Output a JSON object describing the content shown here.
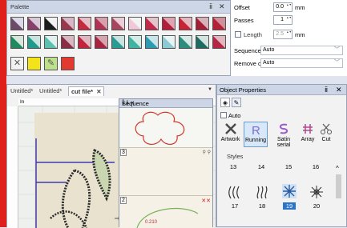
{
  "palette": {
    "title": "Palette",
    "pin_glyph": "ⅱ",
    "close_glyph": "✕",
    "swatches_row1": [
      {
        "c1": "#dcd9e6",
        "c2": "#6b4a6a"
      },
      {
        "c1": "#d7c9d8",
        "c2": "#87406a"
      },
      {
        "c1": "#f2f2f2",
        "c2": "#1c1c1c"
      },
      {
        "c1": "#d9b7c4",
        "c2": "#99354d"
      },
      {
        "c1": "#e3bfc8",
        "c2": "#c52a3e"
      },
      {
        "c1": "#d6a0ac",
        "c2": "#b23454"
      },
      {
        "c1": "#e9cdd7",
        "c2": "#a8465d"
      },
      {
        "c1": "#f3f3f3",
        "c2": "#f0c8d8"
      },
      {
        "c1": "#e6c4cc",
        "c2": "#c2294a"
      },
      {
        "c1": "#dca5b1",
        "c2": "#b31f3a"
      },
      {
        "c1": "#e4b8c1",
        "c2": "#c82335"
      },
      {
        "c1": "#d8b2bb",
        "c2": "#a61e33"
      },
      {
        "c1": "#cf8f9c",
        "c2": "#b52235"
      }
    ],
    "swatches_row2": [
      {
        "c1": "#d4e6dd",
        "c2": "#1e8a5e"
      },
      {
        "c1": "#c8e4e0",
        "c2": "#1f9b8d"
      },
      {
        "c1": "#e2f1ee",
        "c2": "#5bc0b0"
      },
      {
        "c1": "#d9b8c1",
        "c2": "#8a2d45"
      },
      {
        "c1": "#e0b6c0",
        "c2": "#c3233f"
      },
      {
        "c1": "#d7a4ae",
        "c2": "#a82440"
      },
      {
        "c1": "#c9e3e0",
        "c2": "#2a9c94"
      },
      {
        "c1": "#d2ece6",
        "c2": "#3fb4a2"
      },
      {
        "c1": "#c9e5e8",
        "c2": "#2a9bb2"
      },
      {
        "c1": "#e8f3f4",
        "c2": "#8bcad2"
      },
      {
        "c1": "#d6e9e4",
        "c2": "#2c8e7c"
      },
      {
        "c1": "#d4e5e1",
        "c2": "#1d6c63"
      },
      {
        "c1": "#e0b7c1",
        "c2": "#b72544"
      }
    ],
    "tools": [
      {
        "name": "no-color-icon",
        "glyph": "✕",
        "bg": "#f2f2f2"
      },
      {
        "name": "yellow-swatch",
        "glyph": "",
        "bg": "#f4e21a"
      },
      {
        "name": "eyedropper-icon",
        "glyph": "✎",
        "bg": "#bfe08a"
      },
      {
        "name": "red-swatch",
        "glyph": "",
        "bg": "#e23a2e"
      }
    ]
  },
  "options": {
    "offset_label": "Offset",
    "offset_value": "0.0",
    "offset_unit": "mm",
    "passes_label": "Passes",
    "passes_value": "1",
    "length_label": "Length",
    "length_value": "2.5",
    "length_unit": "mm",
    "sequence_label": "Sequence",
    "sequence_value": "Auto",
    "remove_overlaps_label": "Remove overlaps",
    "remove_overlaps_value": "Auto"
  },
  "docs": {
    "tabs": [
      "Untitled*",
      "Untitled*",
      "cut file*"
    ],
    "active_tab_close": "✕",
    "dropdown_glyph": "▼",
    "ruler_unit": "In",
    "ruler_zero": "0"
  },
  "sequence": {
    "title": "Sequence",
    "title_controls": "ⅱ ⅱ ✕",
    "items": [
      "3",
      "2"
    ],
    "ruler_mark": "0.210"
  },
  "props": {
    "title": "Object Properties",
    "pin_glyph": "ⅱ",
    "close_glyph": "✕",
    "auto_label": "Auto",
    "tools": [
      "Artwork",
      "Running",
      "Satin serial",
      "Array",
      "Cut"
    ],
    "styles_label": "Styles",
    "style_numbers_row1": [
      "13",
      "14",
      "15",
      "16"
    ],
    "style_numbers_row2": [
      "17",
      "18",
      "19",
      "20"
    ],
    "selected_style": "19"
  }
}
